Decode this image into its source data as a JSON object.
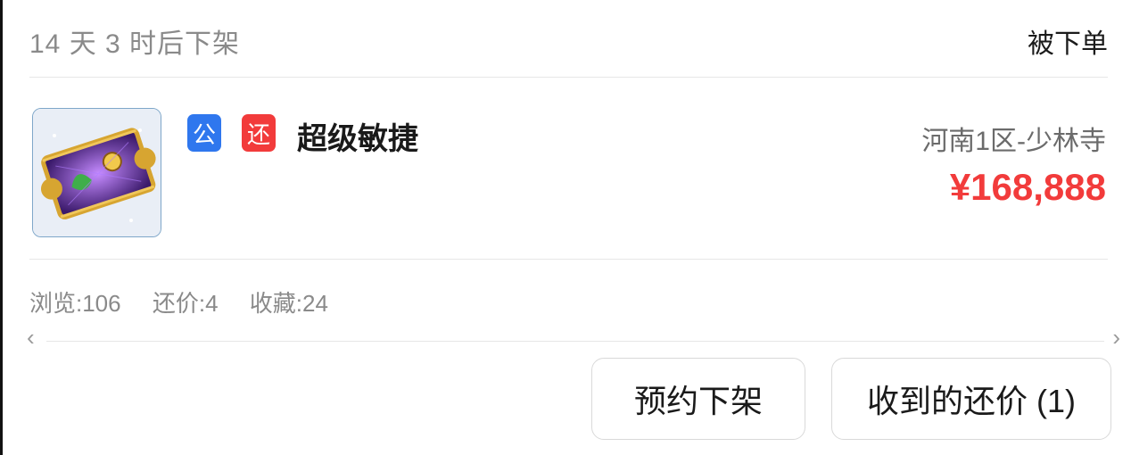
{
  "header": {
    "countdown": "14 天 3 时后下架",
    "status": "被下单"
  },
  "item": {
    "tag_public": "公",
    "tag_counter": "还",
    "name": "超级敏捷",
    "server": "河南1区-少林寺",
    "price": "¥168,888",
    "thumbnail_icon": "magic-scroll-icon"
  },
  "stats": {
    "views": "浏览:106",
    "offers": "还价:4",
    "favorites": "收藏:24"
  },
  "actions": {
    "schedule_label": "预约下架",
    "offers_label": "收到的还价 (1)"
  },
  "colors": {
    "accent_red": "#f23b3b",
    "tag_blue": "#2f77ee"
  }
}
